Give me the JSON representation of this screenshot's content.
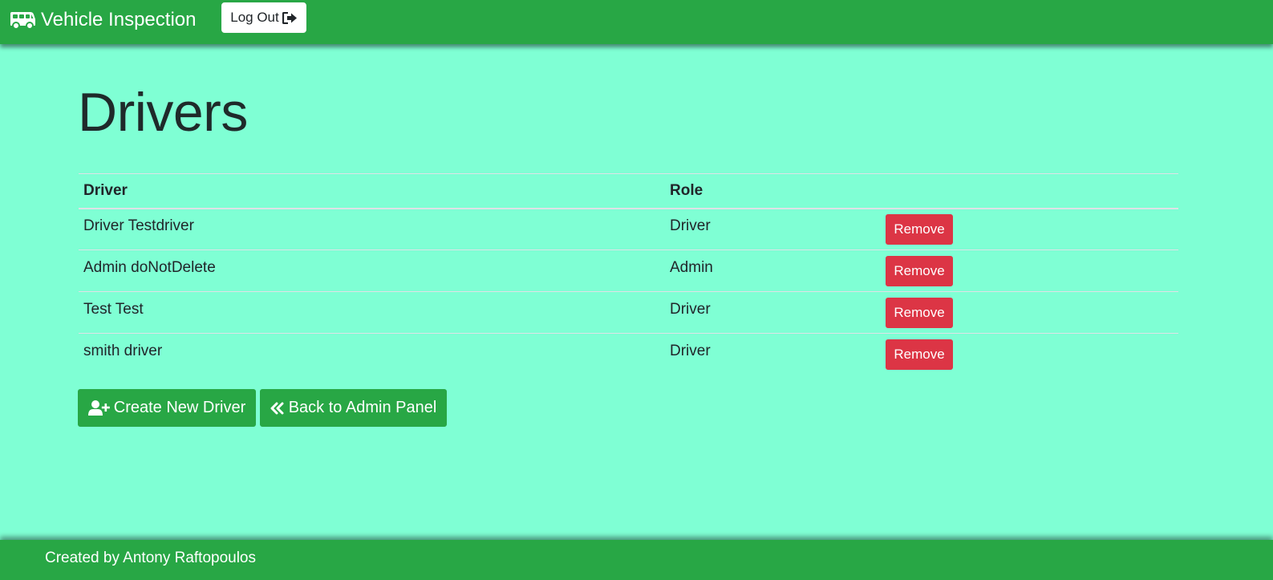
{
  "navbar": {
    "brand": "Vehicle Inspection",
    "brand_icon": "bus-icon",
    "logout_label": "Log Out",
    "logout_icon": "sign-out-icon"
  },
  "page": {
    "title": "Drivers"
  },
  "table": {
    "headers": [
      "Driver",
      "Role",
      ""
    ],
    "rows": [
      {
        "name": "Driver Testdriver",
        "role": "Driver",
        "action": "Remove"
      },
      {
        "name": "Admin doNotDelete",
        "role": "Admin",
        "action": "Remove"
      },
      {
        "name": "Test Test",
        "role": "Driver",
        "action": "Remove"
      },
      {
        "name": "smith driver",
        "role": "Driver",
        "action": "Remove"
      }
    ]
  },
  "actions": {
    "create_label": "Create New Driver",
    "create_icon": "user-plus-icon",
    "back_label": "Back to Admin Panel",
    "back_icon": "double-chevron-left-icon"
  },
  "footer": {
    "text": "Created by Antony Raftopoulos"
  },
  "colors": {
    "background": "#7fffd4",
    "primary_green": "#28a745",
    "danger_red": "#dc3545"
  }
}
